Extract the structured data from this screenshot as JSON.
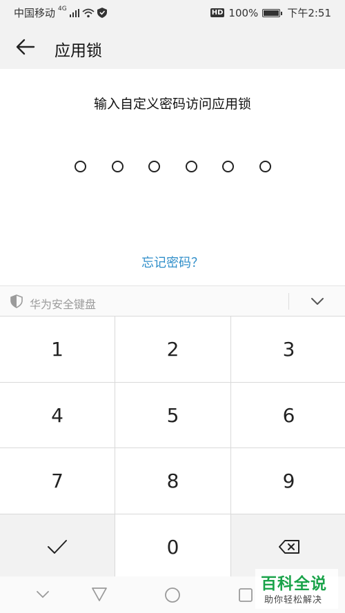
{
  "status_bar": {
    "carrier": "中国移动",
    "network": "4G",
    "battery": "100%",
    "battery_level": 1.0,
    "hd_badge": "HD",
    "time": "下午2:51"
  },
  "header": {
    "title": "应用锁",
    "back_icon": "arrow-left-icon"
  },
  "prompt": "输入自定义密码访问应用锁",
  "pin": {
    "length": 6,
    "entered": 0
  },
  "forgot_link": "忘记密码？",
  "keyboard": {
    "title": "华为安全键盘",
    "keys": [
      "1",
      "2",
      "3",
      "4",
      "5",
      "6",
      "7",
      "8",
      "9"
    ],
    "zero": "0",
    "confirm_icon": "checkmark-icon",
    "delete_icon": "backspace-icon",
    "collapse_icon": "chevron-down-icon"
  },
  "nav_bar": {
    "icons": [
      "hide-nav-icon",
      "back-triangle-icon",
      "home-circle-icon",
      "recents-square-icon"
    ]
  },
  "watermark": {
    "main": "百科全说",
    "sub": "助你轻松解决"
  },
  "colors": {
    "accent_link": "#2f8ec9",
    "watermark_green": "#1aa34a"
  }
}
